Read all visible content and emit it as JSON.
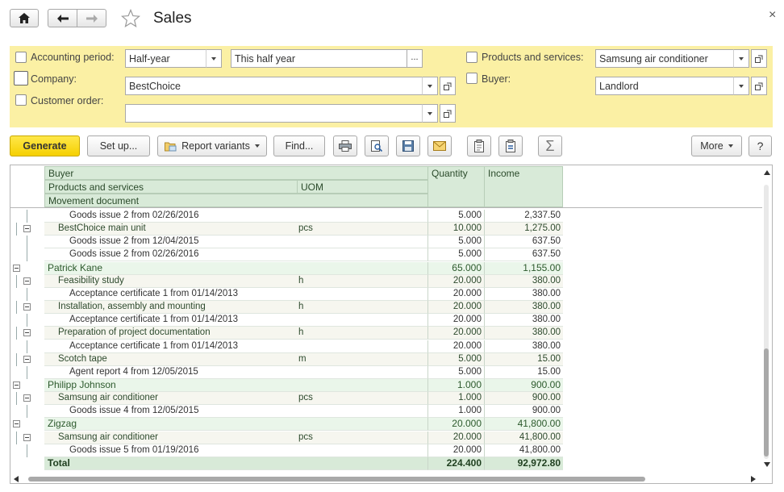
{
  "window": {
    "title": "Sales",
    "close_glyph": "×"
  },
  "nav": {
    "home_icon": "home-icon",
    "back_icon": "arrow-left-icon",
    "forward_icon": "arrow-right-icon",
    "favorite_icon": "star-icon"
  },
  "filters": {
    "accounting_period": {
      "label": "Accounting period:",
      "period_type": "Half-year",
      "period_value": "This half year",
      "dots": "..."
    },
    "company": {
      "label": "Company:",
      "value": "BestChoice"
    },
    "customer_order": {
      "label": "Customer order:",
      "value": ""
    },
    "products_services": {
      "label": "Products and services:",
      "value": "Samsung air conditioner"
    },
    "buyer": {
      "label": "Buyer:",
      "value": "Landlord"
    }
  },
  "toolbar": {
    "generate": "Generate",
    "setup": "Set up...",
    "report_variants": "Report variants",
    "find": "Find...",
    "more": "More",
    "help": "?",
    "sum_glyph": "Σ"
  },
  "report": {
    "headers": {
      "buyer": "Buyer",
      "products": "Products and services",
      "uom": "UOM",
      "movement": "Movement document",
      "quantity": "Quantity",
      "income": "Income"
    },
    "rows": [
      {
        "type": "d",
        "name": "Goods issue 2 from 02/26/2016",
        "uom": "",
        "qty": "5.000",
        "income": "2,337.50"
      },
      {
        "type": "i",
        "name": "BestChoice main unit",
        "uom": "pcs",
        "qty": "10.000",
        "income": "1,275.00"
      },
      {
        "type": "d",
        "name": "Goods issue 2 from 12/04/2015",
        "uom": "",
        "qty": "5.000",
        "income": "637.50"
      },
      {
        "type": "d",
        "name": "Goods issue 2 from 02/26/2016",
        "uom": "",
        "qty": "5.000",
        "income": "637.50"
      },
      {
        "type": "g",
        "name": "Patrick Kane",
        "uom": "",
        "qty": "65.000",
        "income": "1,155.00"
      },
      {
        "type": "i",
        "name": "Feasibility study",
        "uom": "h",
        "qty": "20.000",
        "income": "380.00"
      },
      {
        "type": "d",
        "name": "Acceptance certificate 1 from 01/14/2013",
        "uom": "",
        "qty": "20.000",
        "income": "380.00"
      },
      {
        "type": "i",
        "name": "Installation, assembly and mounting",
        "uom": "h",
        "qty": "20.000",
        "income": "380.00"
      },
      {
        "type": "d",
        "name": "Acceptance certificate 1 from 01/14/2013",
        "uom": "",
        "qty": "20.000",
        "income": "380.00"
      },
      {
        "type": "i",
        "name": "Preparation of project documentation",
        "uom": "h",
        "qty": "20.000",
        "income": "380.00"
      },
      {
        "type": "d",
        "name": "Acceptance certificate 1 from 01/14/2013",
        "uom": "",
        "qty": "20.000",
        "income": "380.00"
      },
      {
        "type": "i",
        "name": "Scotch tape",
        "uom": "m",
        "qty": "5.000",
        "income": "15.00"
      },
      {
        "type": "d",
        "name": "Agent report 4 from 12/05/2015",
        "uom": "",
        "qty": "5.000",
        "income": "15.00"
      },
      {
        "type": "g",
        "name": "Philipp Johnson",
        "uom": "",
        "qty": "1.000",
        "income": "900.00"
      },
      {
        "type": "i",
        "name": "Samsung air conditioner",
        "uom": "pcs",
        "qty": "1.000",
        "income": "900.00"
      },
      {
        "type": "d",
        "name": "Goods issue 4 from 12/05/2015",
        "uom": "",
        "qty": "1.000",
        "income": "900.00"
      },
      {
        "type": "g",
        "name": "Zigzag",
        "uom": "",
        "qty": "20.000",
        "income": "41,800.00"
      },
      {
        "type": "i",
        "name": "Samsung air conditioner",
        "uom": "pcs",
        "qty": "20.000",
        "income": "41,800.00"
      },
      {
        "type": "d",
        "name": "Goods issue 5 from 01/19/2016",
        "uom": "",
        "qty": "20.000",
        "income": "41,800.00"
      },
      {
        "type": "t",
        "name": "Total",
        "uom": "",
        "qty": "224.400",
        "income": "92,972.80"
      }
    ]
  },
  "colors": {
    "filter_bg": "#fbf0a4",
    "generate_bg": "#f5d000",
    "header_bg": "#d8ead8"
  }
}
